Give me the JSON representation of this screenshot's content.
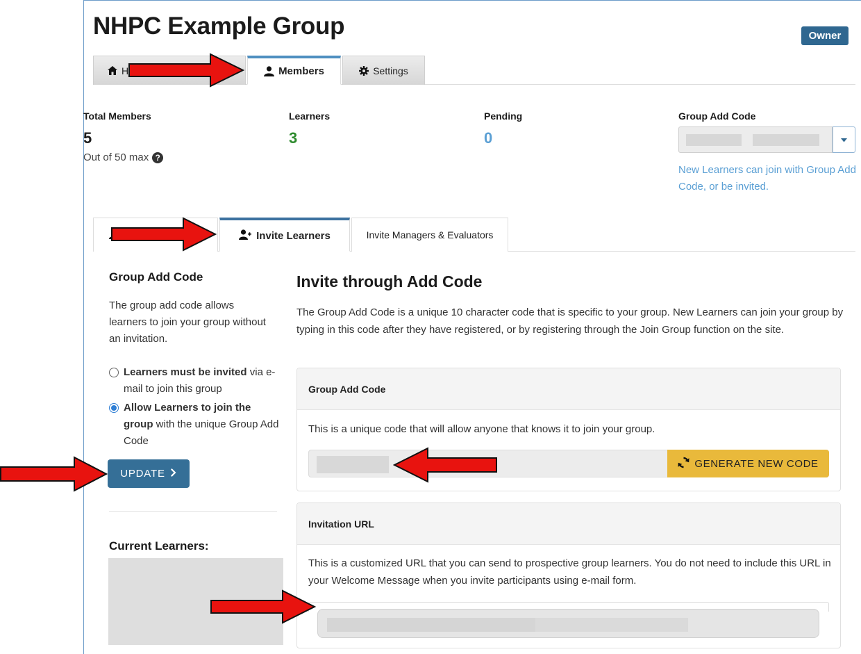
{
  "header": {
    "title": "NHPC Example Group",
    "role_badge": "Owner"
  },
  "top_tabs": [
    {
      "label": "Hom",
      "icon": "home-icon",
      "active": false
    },
    {
      "label": "Members",
      "icon": "user-icon",
      "active": true
    },
    {
      "label": "Settings",
      "icon": "gear-icon",
      "active": false
    }
  ],
  "stats": {
    "total_members": {
      "label": "Total Members",
      "value": "5",
      "sub": "Out of 50 max"
    },
    "learners": {
      "label": "Learners",
      "value": "3",
      "color": "#2e8b2e"
    },
    "pending": {
      "label": "Pending",
      "value": "0",
      "color": "#5a9fd4"
    },
    "group_add_code": {
      "label": "Group Add Code",
      "note": "New Learners can join with Group Add Code, or be invited."
    }
  },
  "inner_tabs": [
    {
      "label": "",
      "icon": "user-icon",
      "active": false
    },
    {
      "label": "Invite Learners",
      "icon": "user-plus-icon",
      "active": true
    },
    {
      "label": "Invite Managers & Evaluators",
      "active": false
    }
  ],
  "left": {
    "heading": "Group Add Code",
    "description": "The group add code allows learners to join your group without an invitation.",
    "options": [
      {
        "bold": "Learners must be invited",
        "rest": " via e-mail to join this group",
        "selected": false
      },
      {
        "bold": "Allow Learners to join the group",
        "rest": " with the unique Group Add Code",
        "selected": true
      }
    ],
    "update_label": "UPDATE",
    "current_learners_heading": "Current Learners:"
  },
  "main": {
    "heading": "Invite through Add Code",
    "description": "The Group Add Code is a unique 10 character code that is specific to your group. New Learners can join your group by typing in this code after they have registered, or by registering through the Join Group function on the site.",
    "code_panel": {
      "title": "Group Add Code",
      "text": "This is a unique code that will allow anyone that knows it to join your group.",
      "generate_label": "GENERATE NEW CODE"
    },
    "url_panel": {
      "title": "Invitation URL",
      "text": "This is a customized URL that you can send to prospective group learners. You do not need to include this URL in your Welcome Message when you invite participants using e-mail form."
    }
  },
  "colors": {
    "accent": "#356f97",
    "tab_highlight": "#4f8fc0",
    "generate_button": "#e9b93b",
    "annotation_arrow": "#e8130f"
  }
}
